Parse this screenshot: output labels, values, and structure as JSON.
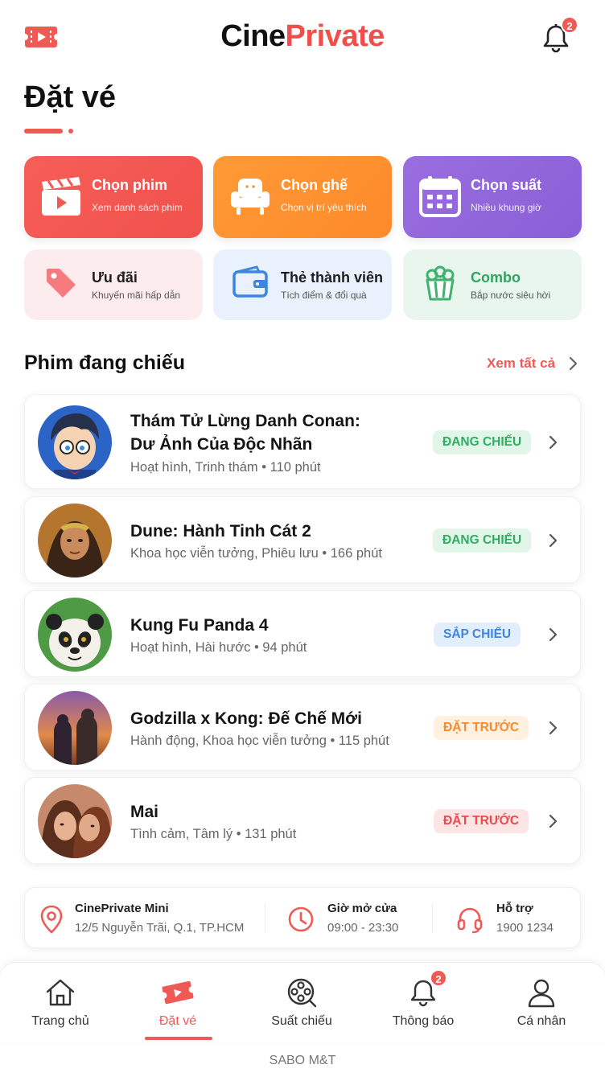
{
  "app": {
    "brand_part1": "Cine",
    "brand_part2": "Private",
    "notification_count": "2",
    "page_title": "Đặt vé",
    "accent_color": "#f05a55"
  },
  "tiles": [
    {
      "title": "Chọn phim",
      "subtitle": "Xem danh sách phim",
      "icon": "clapperboard-icon"
    },
    {
      "title": "Chọn ghế",
      "subtitle": "Chọn vị trí yêu thích",
      "icon": "armchair-icon"
    },
    {
      "title": "Chọn suất",
      "subtitle": "Nhiều khung giờ",
      "icon": "calendar-icon"
    },
    {
      "title": "Ưu đãi",
      "subtitle": "Khuyến mãi hấp dẫn",
      "icon": "tag-icon"
    },
    {
      "title": "Thẻ thành viên",
      "subtitle": "Tích điểm & đổi quà",
      "icon": "wallet-icon"
    },
    {
      "title": "Combo",
      "subtitle": "Bắp nước siêu hời",
      "icon": "popcorn-icon"
    }
  ],
  "section": {
    "title": "Phim đang chiếu",
    "see_all": "Xem tất cả"
  },
  "movies": [
    {
      "title_line1": "Thám Tử Lừng Danh Conan:",
      "title_line2": "Dư Ảnh Của Độc Nhãn",
      "genre": "Hoạt hình, Trinh thám • 110 phút",
      "status": "ĐANG CHIẾU",
      "status_color": "#2fae62"
    },
    {
      "title_line1": "Dune: Hành Tinh Cát 2",
      "genre": "Khoa học viễn tưởng, Phiêu lưu • 166 phút",
      "status": "ĐANG CHIẾU",
      "status_color": "#2fae62"
    },
    {
      "title_line1": "Kung Fu Panda 4",
      "genre": "Hoạt hình, Hài hước • 94 phút",
      "status": "SẮP CHIẾU",
      "status_color": "#3d85e0"
    },
    {
      "title_line1": "Godzilla x Kong: Đế Chế Mới",
      "genre": "Hành động, Khoa học viễn tưởng • 115 phút",
      "status": "ĐẶT TRƯỚC",
      "status_color": "#f58a2e"
    },
    {
      "title_line1": "Mai",
      "genre": "Tình cảm, Tâm lý • 131 phút",
      "status": "ĐẶT TRƯỚC",
      "status_color": "#ea4a4a"
    }
  ],
  "info": {
    "location_label": "CinePrivate Mini",
    "location_value": "12/5 Nguyễn Trãi, Q.1, TP.HCM",
    "hours_label": "Giờ mở cửa",
    "hours_value": "09:00 - 23:30",
    "support_label": "Hỗ trợ",
    "support_value": "1900 1234"
  },
  "nav": [
    {
      "label": "Trang chủ",
      "icon": "home-icon"
    },
    {
      "label": "Đặt vé",
      "icon": "ticket-icon",
      "active": true
    },
    {
      "label": "Suất chiếu",
      "icon": "film-reel-icon"
    },
    {
      "label": "Thông báo",
      "icon": "bell-icon",
      "badge": "2"
    },
    {
      "label": "Cá nhân",
      "icon": "user-icon"
    }
  ],
  "footer": "SABO M&T"
}
